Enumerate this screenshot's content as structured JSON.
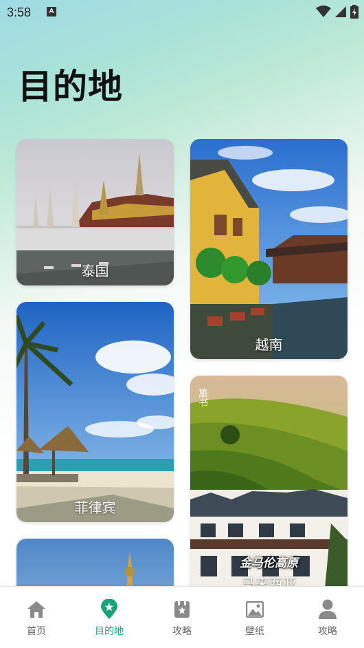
{
  "status_bar": {
    "time": "3:58",
    "notification_icon": "A"
  },
  "page_title": "目的地",
  "destinations": [
    {
      "name": "泰国"
    },
    {
      "name": "越南"
    },
    {
      "name": "菲律宾"
    },
    {
      "name": "马来西亚",
      "overlay_small": "旅书",
      "overlay_caption": "金马伦高原"
    }
  ],
  "nav": {
    "items": [
      {
        "label": "首页",
        "icon": "home-icon"
      },
      {
        "label": "目的地",
        "icon": "location-pin-icon"
      },
      {
        "label": "攻略",
        "icon": "guide-book-icon"
      },
      {
        "label": "壁纸",
        "icon": "wallpaper-icon"
      },
      {
        "label": "攻略",
        "icon": "profile-icon"
      }
    ],
    "active_index": 1,
    "active_color": "#1aa37a",
    "inactive_color": "#8a8a8a"
  }
}
